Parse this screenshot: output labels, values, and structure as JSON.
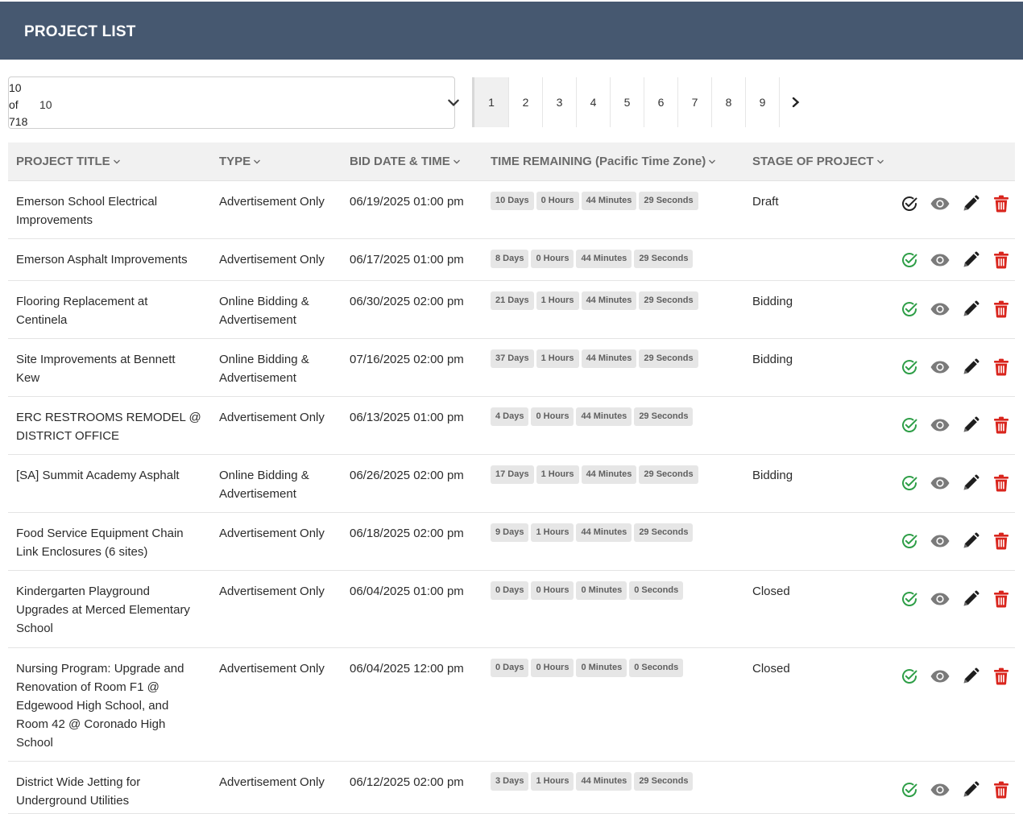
{
  "header": {
    "title": "PROJECT LIST"
  },
  "pager": {
    "count_lines": [
      "10",
      "of",
      "718"
    ],
    "select_value": "10",
    "pages": [
      "1",
      "2",
      "3",
      "4",
      "5",
      "6",
      "7",
      "8",
      "9"
    ],
    "active_page": "1"
  },
  "table": {
    "columns": [
      "PROJECT TITLE",
      "TYPE",
      "BID DATE & TIME",
      "TIME REMAINING (Pacific Time Zone)",
      "STAGE OF PROJECT"
    ],
    "rows": [
      {
        "title": "Emerson School Electrical Improvements",
        "type": "Advertisement Only",
        "bid": "06/19/2025 01:00 pm",
        "time": [
          "10 Days",
          "0 Hours",
          "44 Minutes",
          "29 Seconds"
        ],
        "stage": "Draft",
        "approved": false
      },
      {
        "title": "Emerson Asphalt Improvements",
        "type": "Advertisement Only",
        "bid": "06/17/2025 01:00 pm",
        "time": [
          "8 Days",
          "0 Hours",
          "44 Minutes",
          "29 Seconds"
        ],
        "stage": "",
        "approved": true
      },
      {
        "title": "Flooring Replacement at Centinela",
        "type": "Online Bidding & Advertisement",
        "bid": "06/30/2025 02:00 pm",
        "time": [
          "21 Days",
          "1 Hours",
          "44 Minutes",
          "29 Seconds"
        ],
        "stage": "Bidding",
        "approved": true
      },
      {
        "title": "Site Improvements at Bennett Kew",
        "type": "Online Bidding & Advertisement",
        "bid": "07/16/2025 02:00 pm",
        "time": [
          "37 Days",
          "1 Hours",
          "44 Minutes",
          "29 Seconds"
        ],
        "stage": "Bidding",
        "approved": true
      },
      {
        "title": "ERC RESTROOMS REMODEL @ DISTRICT OFFICE",
        "type": "Advertisement Only",
        "bid": "06/13/2025 01:00 pm",
        "time": [
          "4 Days",
          "0 Hours",
          "44 Minutes",
          "29 Seconds"
        ],
        "stage": "",
        "approved": true
      },
      {
        "title": "[SA] Summit Academy Asphalt",
        "type": "Online Bidding & Advertisement",
        "bid": "06/26/2025 02:00 pm",
        "time": [
          "17 Days",
          "1 Hours",
          "44 Minutes",
          "29 Seconds"
        ],
        "stage": "Bidding",
        "approved": true
      },
      {
        "title": "Food Service Equipment Chain Link Enclosures (6 sites)",
        "type": "Advertisement Only",
        "bid": "06/18/2025 02:00 pm",
        "time": [
          "9 Days",
          "1 Hours",
          "44 Minutes",
          "29 Seconds"
        ],
        "stage": "",
        "approved": true
      },
      {
        "title": "Kindergarten Playground Upgrades at Merced Elementary School",
        "type": "Advertisement Only",
        "bid": "06/04/2025 01:00 pm",
        "time": [
          "0 Days",
          "0 Hours",
          "0 Minutes",
          "0 Seconds"
        ],
        "stage": "Closed",
        "approved": true
      },
      {
        "title": "Nursing Program: Upgrade and Renovation of Room F1 @ Edgewood High School, and Room 42 @ Coronado High School",
        "type": "Advertisement Only",
        "bid": "06/04/2025 12:00 pm",
        "time": [
          "0 Days",
          "0 Hours",
          "0 Minutes",
          "0 Seconds"
        ],
        "stage": "Closed",
        "approved": true
      },
      {
        "title": "District Wide Jetting for Underground Utilities",
        "type": "Advertisement Only",
        "bid": "06/12/2025 02:00 pm",
        "time": [
          "3 Days",
          "1 Hours",
          "44 Minutes",
          "29 Seconds"
        ],
        "stage": "",
        "approved": true
      }
    ]
  },
  "icons": {
    "approve": "check-circle-icon",
    "view": "eye-icon",
    "edit": "pencil-icon",
    "delete": "trash-icon"
  },
  "colors": {
    "header_bg": "#465870",
    "approved": "#2e9e47",
    "pending": "#222222",
    "view": "#7a7a7a",
    "delete": "#d9251d"
  }
}
